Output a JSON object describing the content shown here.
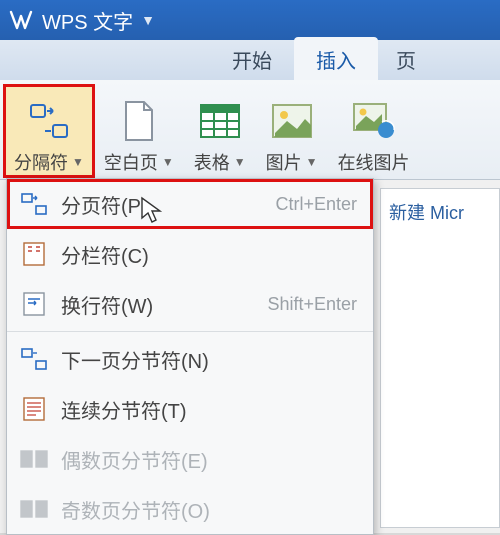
{
  "title": "WPS 文字",
  "tabs": {
    "start": "开始",
    "insert": "插入",
    "page_partial": "页"
  },
  "ribbon": {
    "separator": "分隔符",
    "blank_page": "空白页",
    "table": "表格",
    "picture": "图片",
    "online_picture": "在线图片"
  },
  "dropdown": {
    "page_break": {
      "label": "分页符(P)",
      "shortcut": "Ctrl+Enter"
    },
    "column_break": {
      "label": "分栏符(C)"
    },
    "line_break": {
      "label": "换行符(W)",
      "shortcut": "Shift+Enter"
    },
    "next_page_sec": {
      "label": "下一页分节符(N)"
    },
    "continuous_sec": {
      "label": "连续分节符(T)"
    },
    "even_page_sec": {
      "label": "偶数页分节符(E)"
    },
    "odd_page_sec": {
      "label": "奇数页分节符(O)"
    }
  },
  "doc_tab": "新建 Micr"
}
